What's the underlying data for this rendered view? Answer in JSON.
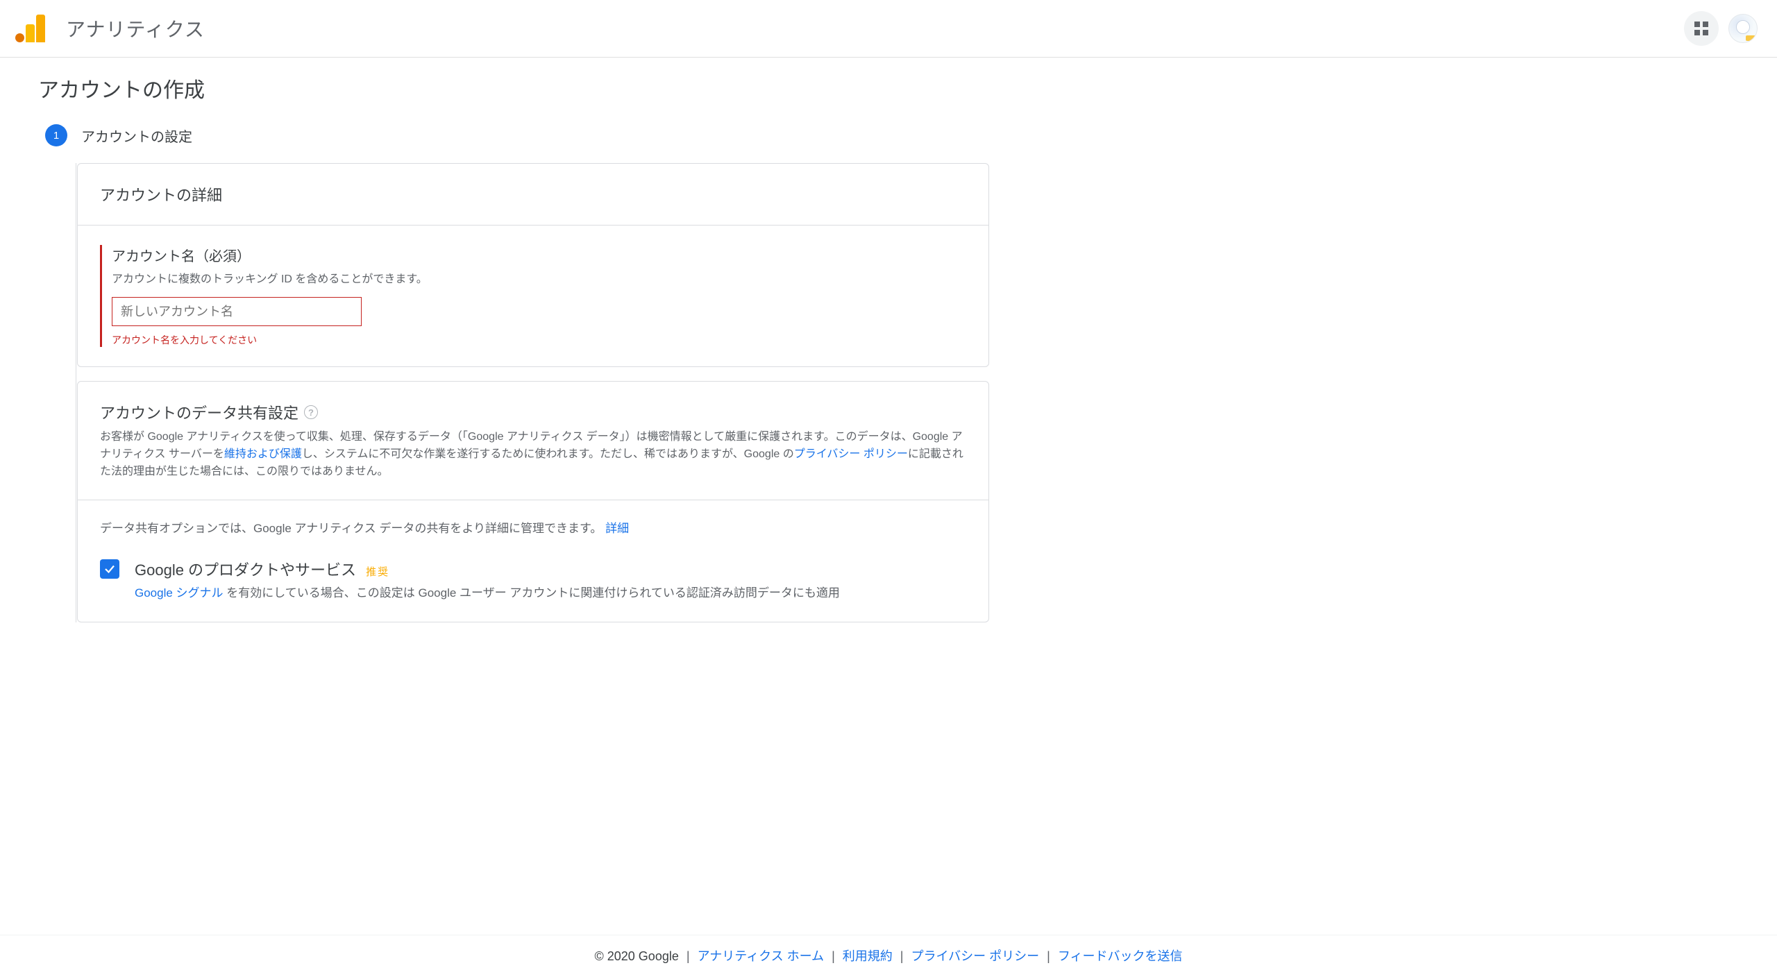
{
  "header": {
    "brand": "アナリティクス"
  },
  "page": {
    "title": "アカウントの作成"
  },
  "step": {
    "number": "1",
    "label": "アカウントの設定"
  },
  "detailsCard": {
    "title": "アカウントの詳細",
    "field": {
      "label": "アカウント名（必須）",
      "hint": "アカウントに複数のトラッキング ID を含めることができます。",
      "placeholder": "新しいアカウント名",
      "error": "アカウント名を入力してください"
    }
  },
  "sharingCard": {
    "title": "アカウントのデータ共有設定",
    "desc_part1": "お客様が Google アナリティクスを使って収集、処理、保存するデータ（「Google アナリティクス データ」）は機密情報として厳重に保護されます。このデータは、Google アナリティクス サーバーを",
    "desc_link1": "維持および保護",
    "desc_part2": "し、システムに不可欠な作業を遂行するために使われます。ただし、稀ではありますが、Google の",
    "desc_link2": "プライバシー ポリシー",
    "desc_part3": "に記載された法的理由が生じた場合には、この限りではありません。",
    "optionIntro_part1": "データ共有オプションでは、Google アナリティクス データの共有をより詳細に管理できます。",
    "optionIntro_link": "詳細",
    "checkbox": {
      "title": "Google のプロダクトやサービス",
      "badge": "推奨",
      "desc_link": "Google シグナル",
      "desc_rest": " を有効にしている場合、この設定は Google ユーザー アカウントに関連付けられている認証済み訪問データにも適用"
    }
  },
  "footer": {
    "copyright": "© 2020 Google",
    "links": {
      "home": "アナリティクス ホーム",
      "tos": "利用規約",
      "privacy": "プライバシー ポリシー",
      "feedback": "フィードバックを送信"
    }
  }
}
